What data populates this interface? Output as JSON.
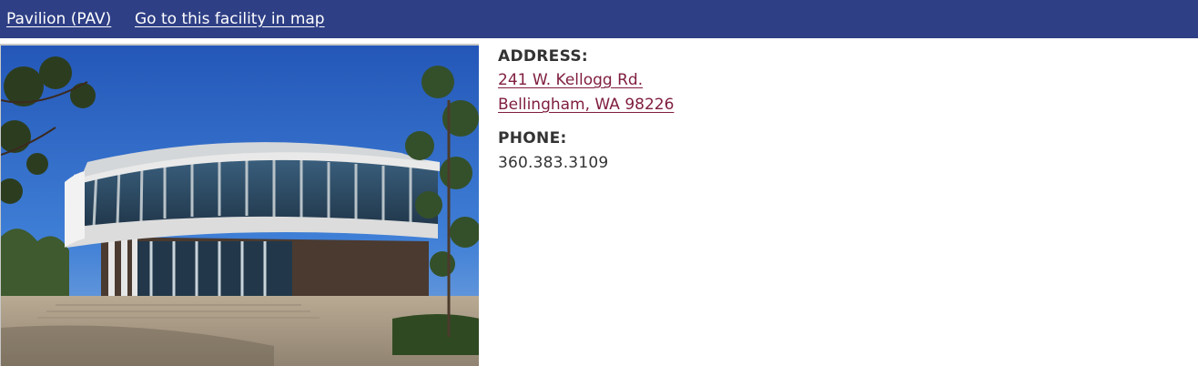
{
  "header": {
    "facility_name": "Pavilion (PAV)",
    "map_link": "Go to this facility in map"
  },
  "details": {
    "address_label": "ADDRESS:",
    "address_line1": "241 W. Kellogg Rd.",
    "address_line2": "Bellingham, WA 98226",
    "phone_label": "PHONE:",
    "phone_value": "360.383.3109"
  },
  "photo": {
    "subject": "Pavilion building exterior photo"
  },
  "colors": {
    "header_bg": "#2e3f85",
    "header_text": "#ffffff",
    "link": "#7f1d3f",
    "body_text": "#333333"
  }
}
